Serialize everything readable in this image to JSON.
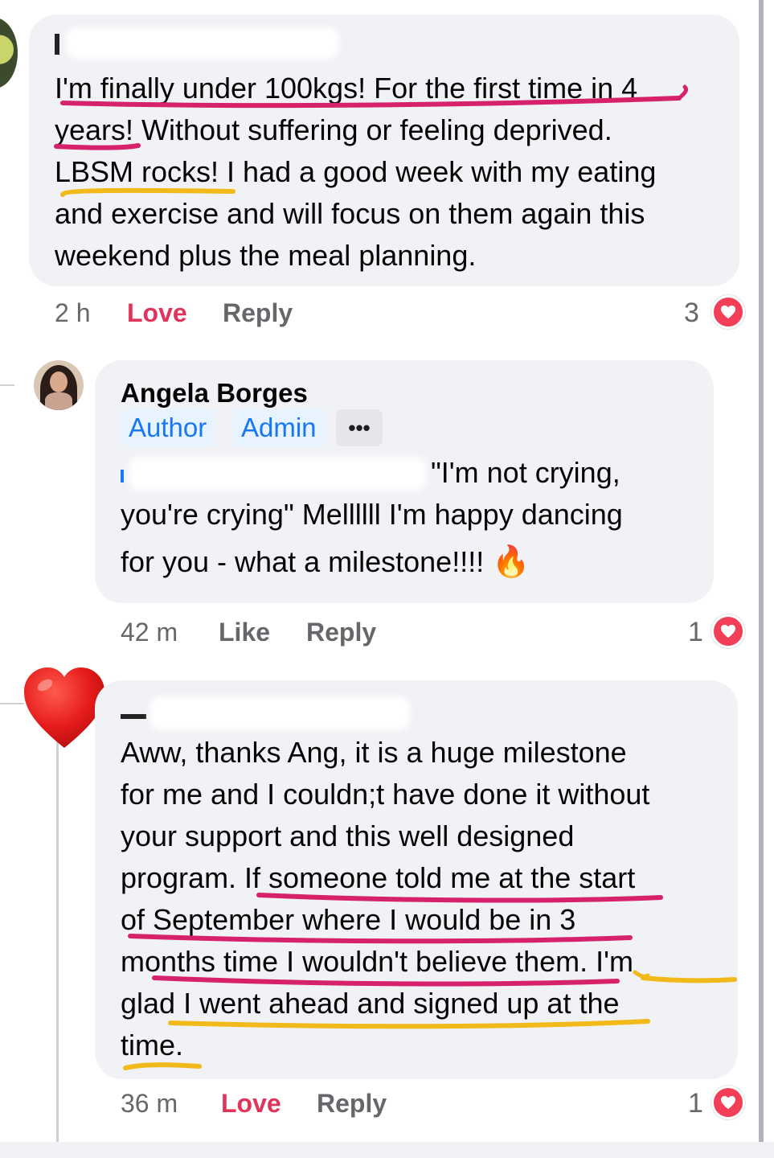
{
  "comments": [
    {
      "text_lines": [
        "I'm finally under 100kgs! For the first time in 4",
        "years! Without suffering or feeling deprived.",
        "LBSM rocks! I had a good week with my eating",
        "and exercise and will focus on them again this",
        "weekend plus the meal planning."
      ],
      "time": "2 h",
      "reaction_label": "Love",
      "reply_label": "Reply",
      "reaction_count": "3"
    },
    {
      "author": "Angela Borges",
      "badges": [
        "Author",
        "Admin"
      ],
      "more_label": "•••",
      "text_lines": [
        "\"I'm not crying,",
        "you're crying\" Mellllll I'm happy dancing",
        "for you - what a milestone!!!!"
      ],
      "emoji": "🔥",
      "time": "42 m",
      "reaction_label": "Like",
      "reply_label": "Reply",
      "reaction_count": "1"
    },
    {
      "text_lines": [
        "Aww, thanks Ang, it is a huge milestone",
        "for me and I couldn;t have done it without",
        "your support and this well designed",
        "program. If someone told me at the start",
        "of September where I would be in 3",
        "months time I wouldn't believe them. I'm",
        "glad I went ahead and signed up at the",
        "time."
      ],
      "time": "36 m",
      "reaction_label": "Love",
      "reply_label": "Reply",
      "reaction_count": "1"
    }
  ],
  "icons": {
    "reaction": "heart-icon",
    "sticker": "red-heart-icon",
    "emoji": "fire-icon"
  },
  "colors": {
    "love": "#e0345a",
    "badge_bg": "#e7f3ff",
    "badge_text": "#1877f2",
    "bubble": "#f0f2f5",
    "underline_pink": "#d6226a",
    "underline_yellow": "#f2b91b"
  }
}
